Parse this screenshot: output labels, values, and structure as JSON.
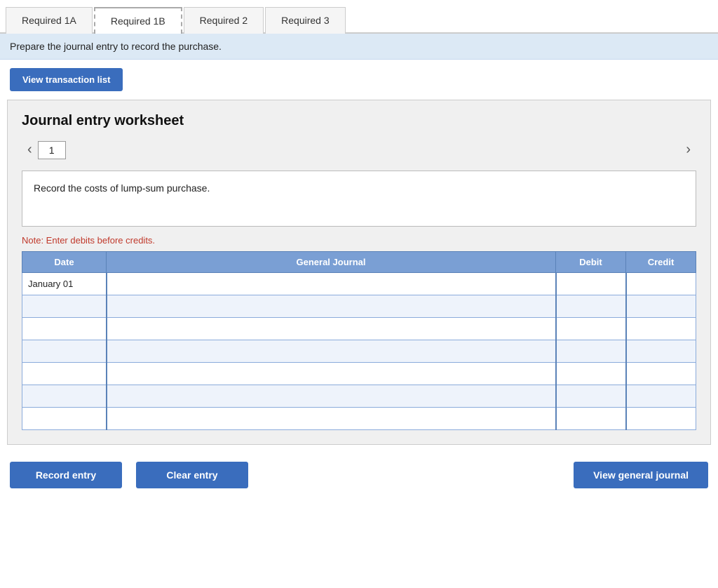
{
  "tabs": [
    {
      "id": "req1a",
      "label": "Required 1A",
      "active": false
    },
    {
      "id": "req1b",
      "label": "Required 1B",
      "active": true
    },
    {
      "id": "req2",
      "label": "Required 2",
      "active": false
    },
    {
      "id": "req3",
      "label": "Required 3",
      "active": false
    }
  ],
  "instruction": "Prepare the journal entry to record the purchase.",
  "toolbar": {
    "view_transaction_label": "View transaction list"
  },
  "worksheet": {
    "title": "Journal entry worksheet",
    "page_number": "1",
    "entry_description": "Record the costs of lump-sum purchase.",
    "note": "Note: Enter debits before credits.",
    "table": {
      "headers": [
        "Date",
        "General Journal",
        "Debit",
        "Credit"
      ],
      "rows": [
        {
          "date": "January 01",
          "journal": "",
          "debit": "",
          "credit": ""
        },
        {
          "date": "",
          "journal": "",
          "debit": "",
          "credit": ""
        },
        {
          "date": "",
          "journal": "",
          "debit": "",
          "credit": ""
        },
        {
          "date": "",
          "journal": "",
          "debit": "",
          "credit": ""
        },
        {
          "date": "",
          "journal": "",
          "debit": "",
          "credit": ""
        },
        {
          "date": "",
          "journal": "",
          "debit": "",
          "credit": ""
        },
        {
          "date": "",
          "journal": "",
          "debit": "",
          "credit": ""
        }
      ]
    }
  },
  "buttons": {
    "record_entry": "Record entry",
    "clear_entry": "Clear entry",
    "view_general_journal": "View general journal"
  },
  "icons": {
    "left_arrow": "‹",
    "right_arrow": "›"
  }
}
